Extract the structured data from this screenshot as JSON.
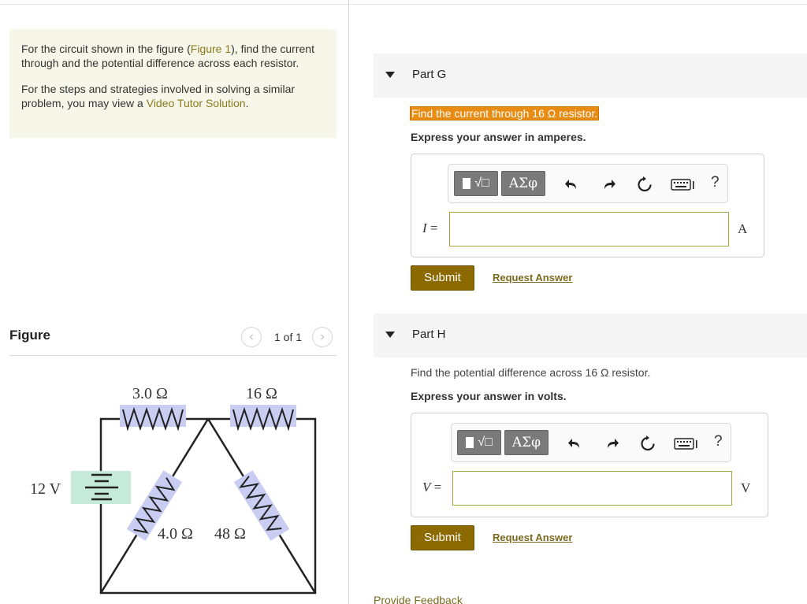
{
  "intro": {
    "line1_pre": "For the circuit shown in the figure (",
    "figure_link": "Figure 1",
    "line1_post": "), find the current through and the potential difference across each resistor.",
    "line2_pre": "For the steps and strategies involved in solving a similar problem, you may view a ",
    "video_link": "Video Tutor Solution",
    "line2_post": "."
  },
  "figure": {
    "title": "Figure",
    "pager_text": "1 of 1",
    "prev_icon": "chevron-left-icon",
    "next_icon": "chevron-right-icon",
    "labels": {
      "r1": "3.0 Ω",
      "r2": "16 Ω",
      "r3": "4.0 Ω",
      "r4": "48 Ω",
      "battery": "12 V"
    },
    "colors": {
      "resistor_fill": "#c9cdf2",
      "battery_fill": "#c5ead9"
    }
  },
  "parts": [
    {
      "title": "Part G",
      "question": "Find the current through 16 Ω resistor.",
      "express": "Express your answer in amperes.",
      "variable": "I",
      "equals": "=",
      "unit": "A",
      "input_value": "",
      "submit_label": "Submit",
      "request_label": "Request Answer"
    },
    {
      "title": "Part H",
      "question": "Find the potential difference across 16 Ω resistor.",
      "express": "Express your answer in volts.",
      "variable": "V",
      "equals": "=",
      "unit": "V",
      "input_value": "",
      "submit_label": "Submit",
      "request_label": "Request Answer"
    }
  ],
  "toolbar": {
    "templates_label": "√□",
    "greek_label": "ΑΣφ",
    "undo_icon": "undo-icon",
    "redo_icon": "redo-icon",
    "reset_icon": "reset-icon",
    "keyboard_icon": "keyboard-icon",
    "help_label": "?"
  },
  "footer": {
    "feedback_label": "Provide Feedback"
  },
  "theme": {
    "accent": "#8d6a00",
    "highlight": "#e98c13",
    "link": "#8a7a1e"
  }
}
